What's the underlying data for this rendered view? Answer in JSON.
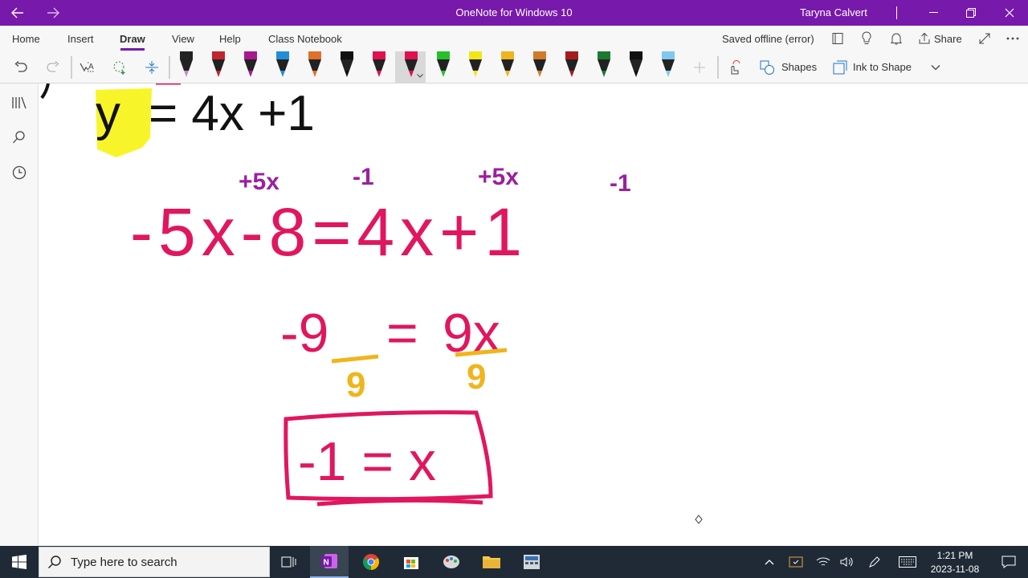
{
  "window": {
    "title": "OneNote for Windows 10",
    "user": "Taryna Calvert",
    "accent": "#7719aa"
  },
  "tabs": [
    {
      "label": "Home"
    },
    {
      "label": "Insert"
    },
    {
      "label": "Draw"
    },
    {
      "label": "View"
    },
    {
      "label": "Help"
    },
    {
      "label": "Class Notebook"
    }
  ],
  "status": {
    "saved_text": "Saved offline (error)",
    "share_label": "Share"
  },
  "ribbon": {
    "shapes_label": "Shapes",
    "ink_to_shape_label": "Ink to Shape",
    "pens": [
      {
        "color": "#222222",
        "tip": "#c08fc6"
      },
      {
        "color": "#c0262d",
        "tip": "#c0262d"
      },
      {
        "color": "#a8198f",
        "tip": "#a8198f"
      },
      {
        "color": "#1f8fd6",
        "tip": "#1f8fd6"
      },
      {
        "color": "#e0702a",
        "tip": "#e0702a"
      },
      {
        "color": "#111111",
        "tip": "#111111"
      },
      {
        "color": "#e0114f",
        "tip": "#e0114f"
      },
      {
        "color": "#e0114f",
        "tip": "#e0114f"
      },
      {
        "color": "#24c12a",
        "tip": "#24c12a"
      },
      {
        "color": "#f4e51a",
        "tip": "#f4e51a"
      },
      {
        "color": "#f0b41c",
        "tip": "#f0b41c"
      },
      {
        "color": "#d07a2a",
        "tip": "#d07a2a"
      },
      {
        "color": "#a61c1c",
        "tip": "#a61c1c"
      },
      {
        "color": "#1b7a2f",
        "tip": "#1b7a2f"
      },
      {
        "color": "#111111",
        "tip": "#111111"
      },
      {
        "color": "#7fc8f0",
        "tip": "#7fc8f0"
      }
    ]
  },
  "ink": {
    "typed_line": {
      "lhs": "y",
      "rhs": "= 4x +1"
    },
    "annotations": [
      {
        "text": "+5x",
        "color": "#9b1fa0"
      },
      {
        "text": "-1",
        "color": "#9b1fa0"
      },
      {
        "text": "+5x",
        "color": "#9b1fa0"
      },
      {
        "text": "-1",
        "color": "#9b1fa0"
      }
    ],
    "line1": "-5x-8=4x+1",
    "line2_left": "-9",
    "line2_eq": "=",
    "line2_right": "9x",
    "divisors": [
      "9",
      "9"
    ],
    "answer": "-1 = x",
    "pink": "#e0175e",
    "gold": "#f0b41c"
  },
  "taskbar": {
    "search_placeholder": "Type here to search",
    "time": "1:21 PM",
    "date": "2023-11-08"
  }
}
